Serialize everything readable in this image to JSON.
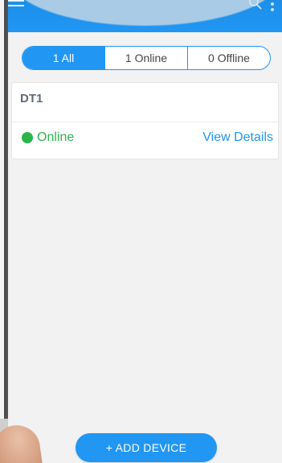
{
  "tabs": [
    {
      "label": "1 All",
      "active": true
    },
    {
      "label": "1 Online",
      "active": false
    },
    {
      "label": "0 Offline",
      "active": false
    }
  ],
  "device": {
    "name": "DT1",
    "status": "Online",
    "status_color": "#2ab54b",
    "details_label": "View Details"
  },
  "add_button_label": "+ ADD DEVICE",
  "header": {
    "icons": [
      "menu-icon",
      "search-icon",
      "more-icon"
    ]
  },
  "colors": {
    "accent": "#2196f3",
    "online": "#2ab54b"
  }
}
